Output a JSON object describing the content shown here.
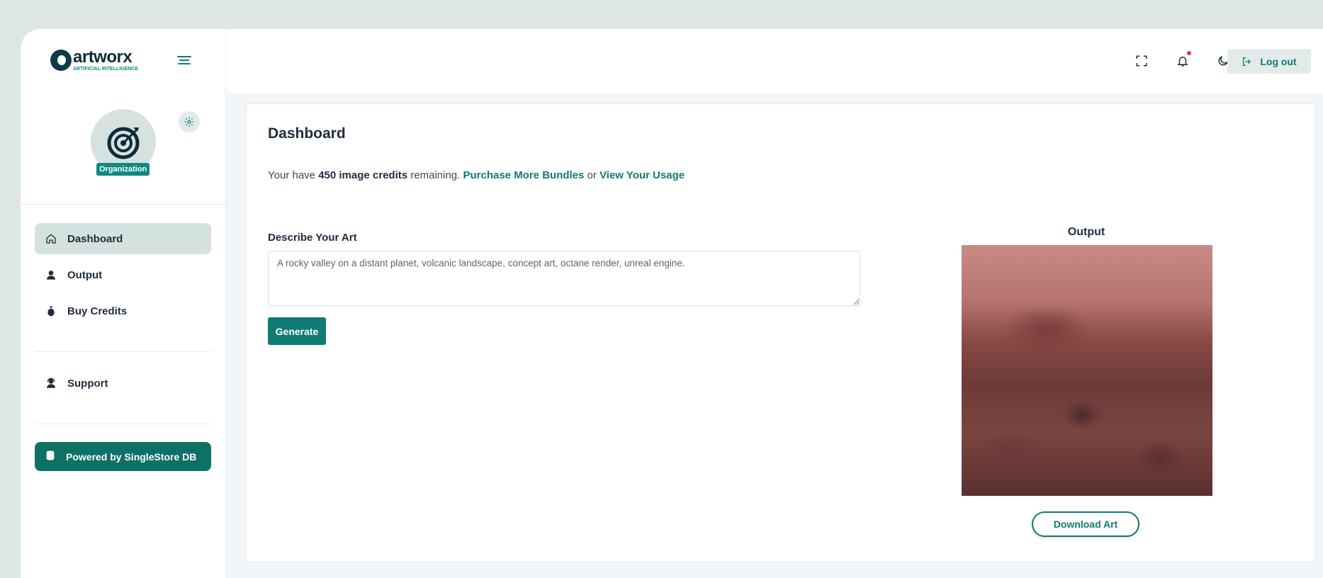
{
  "brand": {
    "name": "artworx",
    "tagline": "ARTIFICIAL INTELLIGENCE"
  },
  "profile": {
    "badge": "Organization"
  },
  "sidebar": {
    "items": [
      {
        "label": "Dashboard",
        "icon": "home-icon",
        "active": true
      },
      {
        "label": "Output",
        "icon": "user-icon"
      },
      {
        "label": "Buy Credits",
        "icon": "money-bag-icon"
      },
      {
        "label": "Support",
        "icon": "support-agent-icon"
      }
    ],
    "powered_label": "Powered by SingleStore DB"
  },
  "topbar": {
    "logout_label": "Log out"
  },
  "main": {
    "title": "Dashboard",
    "credits": {
      "prefix": "Your have",
      "amount": "450 image credits",
      "suffix": "remaining.",
      "purchase_link": "Purchase More Bundles",
      "or": "or",
      "usage_link": "View Your Usage"
    },
    "prompt_label": "Describe Your Art",
    "prompt_value": "A rocky valley on a distant planet, volcanic landscape, concept art, octane render, unreal engine.",
    "generate_label": "Generate",
    "output_label": "Output",
    "download_label": "Download Art"
  },
  "colors": {
    "accent": "#0f7b72",
    "accent_dark": "#0e7165",
    "active_bg": "#d4e2df",
    "page_bg": "#dce6e3",
    "notification_dot": "#e53935"
  }
}
